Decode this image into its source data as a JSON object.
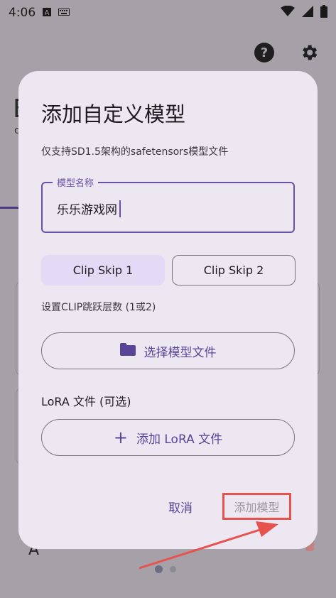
{
  "status_bar": {
    "time": "4:06",
    "notification_icons": [
      "a-box-icon",
      "keyboard-icon"
    ],
    "right_icons": [
      "wifi-icon",
      "signal-icon",
      "battery-icon"
    ]
  },
  "background": {
    "title_fragment": "E",
    "subtitle_fragment": "c",
    "bottom_text_fragment": "A"
  },
  "dialog": {
    "title": "添加自定义模型",
    "description": "仅支持SD1.5架构的safetensors模型文件",
    "name_field": {
      "label": "模型名称",
      "value": "乐乐游戏网"
    },
    "clip_skip_options": [
      {
        "label": "Clip Skip 1",
        "selected": true
      },
      {
        "label": "Clip Skip 2",
        "selected": false
      }
    ],
    "clip_hint": "设置CLIP跳跃层数 (1或2)",
    "select_file_button": "选择模型文件",
    "lora_section_label": "LoRA 文件 (可选)",
    "add_lora_button": "添加 LoRA 文件",
    "cancel_button": "取消",
    "confirm_button": "添加模型"
  },
  "pager": {
    "total": 2,
    "active": 1
  },
  "colors": {
    "accent": "#5a4498",
    "dialog_bg": "#ede7f2",
    "scrim": "#a6a1a8",
    "selected_segment": "#e3dbf5",
    "annotation_red": "#e8524e"
  }
}
